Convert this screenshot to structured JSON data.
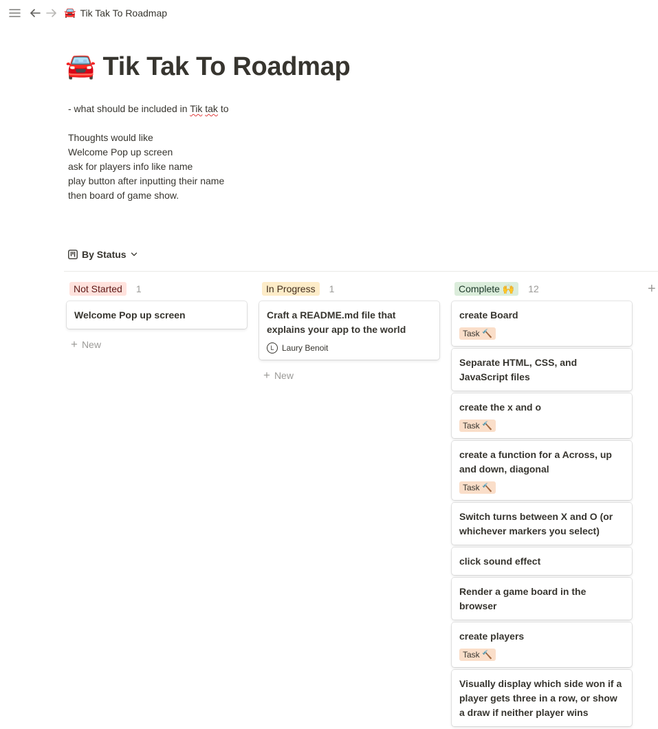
{
  "topbar": {
    "menu_icon": "menu-icon",
    "back_icon": "arrow-left-icon",
    "forward_icon": "arrow-right-icon"
  },
  "breadcrumb": {
    "emoji": "🚘",
    "title": "Tik Tak To Roadmap"
  },
  "page": {
    "emoji": "🚘",
    "title": "Tik Tak To Roadmap",
    "description": [
      "- what should be included in Tik tak to",
      "",
      "Thoughts would like",
      "Welcome Pop up screen",
      "ask for players info like name",
      "play button after inputting their name",
      "then board of game show."
    ]
  },
  "view": {
    "label": "By Status",
    "icon": "board-view-icon"
  },
  "new_label": "New",
  "columns": [
    {
      "name": "Not Started",
      "count": "1",
      "color": "#ffe2dd",
      "text_color": "#5d1715",
      "cards": [
        {
          "title": "Welcome Pop up screen"
        }
      ]
    },
    {
      "name": "In Progress",
      "count": "1",
      "color": "#fdecc8",
      "text_color": "#402c1b",
      "cards": [
        {
          "title": "Craft a README.md file that explains your app to the world",
          "person_initial": "L",
          "person": "Laury Benoit"
        }
      ]
    },
    {
      "name": "Complete 🙌",
      "count": "12",
      "color": "#dbeddb",
      "text_color": "#1c3829",
      "cards": [
        {
          "title": "create Board",
          "tag": "Task 🔨"
        },
        {
          "title": "Separate HTML, CSS, and JavaScript files"
        },
        {
          "title": "create the x and o",
          "tag": "Task 🔨"
        },
        {
          "title": "create a function for a Across, up and down, diagonal",
          "tag": "Task 🔨"
        },
        {
          "title": "Switch turns between X and O (or whichever markers you select)"
        },
        {
          "title": "click sound effect"
        },
        {
          "title": "Render a game board in the browser"
        },
        {
          "title": "create players",
          "tag": "Task 🔨"
        },
        {
          "title": "Visually display which side won if a player gets three in a row, or show a draw if neither player wins"
        }
      ]
    }
  ],
  "add_group_icon": "plus-icon"
}
